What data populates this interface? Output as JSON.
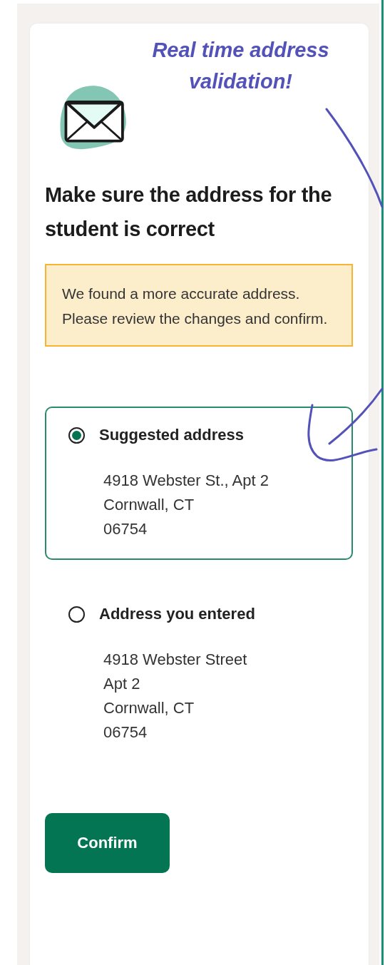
{
  "annotation": "Real time address validation!",
  "heading": "Make sure the address for the student is correct",
  "alert": "We found a more accurate address. Please review the changes and confirm.",
  "options": [
    {
      "title": "Suggested address",
      "selected": true,
      "lines": [
        "4918 Webster St., Apt 2",
        "Cornwall, CT",
        "06754"
      ]
    },
    {
      "title": "Address you entered",
      "selected": false,
      "lines": [
        "4918 Webster Street",
        "Apt 2",
        "Cornwall, CT",
        "06754"
      ]
    }
  ],
  "button": "Confirm"
}
